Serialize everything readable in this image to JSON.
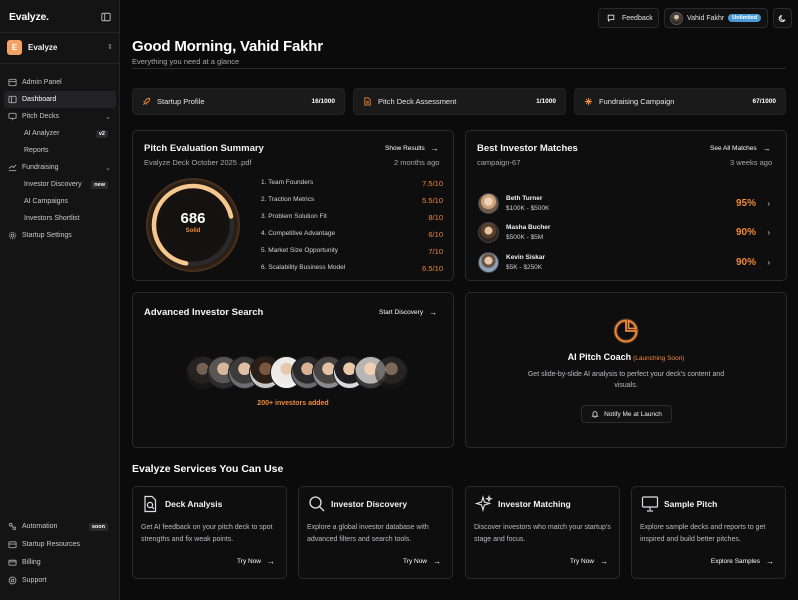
{
  "app": {
    "logo": "Evalyze",
    "workspace_initial": "E",
    "workspace_name": "Evalyze"
  },
  "nav": {
    "admin_panel": "Admin Panel",
    "dashboard": "Dashboard",
    "pitch_decks": "Pitch Decks",
    "ai_analyzer": "AI Analyzer",
    "ai_analyzer_tag": "v2",
    "reports": "Reports",
    "fundraising": "Fundraising",
    "investor_discovery": "Investor Discovery",
    "investor_discovery_tag": "new",
    "ai_campaigns": "AI Campaigns",
    "investors_shortlist": "Investors Shortlist",
    "startup_settings": "Startup Settings",
    "automation": "Automation",
    "automation_tag": "soon",
    "startup_resources": "Startup Resources",
    "billing": "Billing",
    "support": "Support"
  },
  "topbar": {
    "feedback": "Feedback",
    "user_name": "Vahid Fakhr",
    "plan": "Unlimited"
  },
  "header": {
    "greeting": "Good Morning, Vahid Fakhr",
    "subtitle": "Everything you need at a glance"
  },
  "progress": [
    {
      "label": "Startup Profile",
      "value": "16/1000"
    },
    {
      "label": "Pitch Deck Assessment",
      "value": "1/1000"
    },
    {
      "label": "Fundraising Campaign",
      "value": "67/1000"
    }
  ],
  "pitch_eval": {
    "title": "Pitch Evaluation Summary",
    "link": "Show Results",
    "deck": "Evalyze Deck October 2025 .pdf",
    "time": "2 months ago",
    "score": "686",
    "score_value": 686,
    "score_max": 1000,
    "score_label": "Solid",
    "criteria": [
      {
        "label": "1. Team Founders",
        "value": "7.5/10"
      },
      {
        "label": "2. Traction Metrics",
        "value": "5.5/10"
      },
      {
        "label": "3. Problem Solution Fit",
        "value": "8/10"
      },
      {
        "label": "4. Competitive Advantage",
        "value": "6/10"
      },
      {
        "label": "5. Market Size Opportunity",
        "value": "7/10"
      },
      {
        "label": "6. Scalability Business Model",
        "value": "6.5/10"
      }
    ]
  },
  "matches": {
    "title": "Best Investor Matches",
    "link": "See All Matches",
    "campaign": "campaign-67",
    "time": "3 weeks ago",
    "investors": [
      {
        "name": "Beth Turner",
        "range": "$100K - $500K",
        "match": "95%"
      },
      {
        "name": "Masha Bucher",
        "range": "$500K - $5M",
        "match": "90%"
      },
      {
        "name": "Kevin Siskar",
        "range": "$5K - $250K",
        "match": "90%"
      }
    ]
  },
  "search": {
    "title": "Advanced Investor Search",
    "link": "Start Discovery",
    "added": "200+ investors added"
  },
  "coach": {
    "title": "AI Pitch Coach",
    "soon": "(Launching Soon)",
    "desc": "Get slide-by-slide AI analysis to perfect your deck's content and visuals.",
    "button": "Notify Me at Launch"
  },
  "services": {
    "heading": "Evalyze Services You Can Use",
    "items": [
      {
        "title": "Deck Analysis",
        "desc": "Get AI feedback on your pitch deck to spot strengths and fix weak points.",
        "action": "Try Now"
      },
      {
        "title": "Investor Discovery",
        "desc": "Explore a global investor database with advanced filters and search tools.",
        "action": "Try Now"
      },
      {
        "title": "Investor Matching",
        "desc": "Discover investors who match your startup's stage and focus.",
        "action": "Try Now"
      },
      {
        "title": "Sample Pitch",
        "desc": "Explore sample decks and reports to get inspired and build better pitches.",
        "action": "Explore Samples"
      }
    ]
  },
  "colors": {
    "accent": "#f08a3c",
    "badge_blue": "#4a9ad8",
    "workspace": "#f3a266"
  }
}
